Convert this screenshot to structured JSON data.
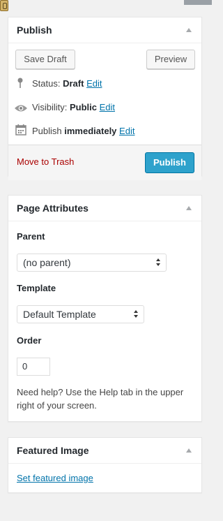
{
  "publish_box": {
    "title": "Publish",
    "save_draft_label": "Save Draft",
    "preview_label": "Preview",
    "status_label": "Status:",
    "status_value": "Draft",
    "visibility_label": "Visibility:",
    "visibility_value": "Public",
    "publish_label": "Publish",
    "publish_value": "immediately",
    "edit_label": "Edit",
    "trash_label": "Move to Trash",
    "publish_button_label": "Publish"
  },
  "attributes_box": {
    "title": "Page Attributes",
    "parent_label": "Parent",
    "parent_value": "(no parent)",
    "template_label": "Template",
    "template_value": "Default Template",
    "order_label": "Order",
    "order_value": "0",
    "help_text": "Need help? Use the Help tab in the upper right of your screen."
  },
  "featured_box": {
    "title": "Featured Image",
    "link_label": "Set featured image"
  },
  "colors": {
    "accent": "#2ea2cc",
    "link": "#0073aa",
    "trash": "#aa0000"
  },
  "icons": [
    "pin-icon",
    "eye-icon",
    "calendar-icon",
    "collapse-arrow-icon",
    "select-arrows-icon"
  ]
}
